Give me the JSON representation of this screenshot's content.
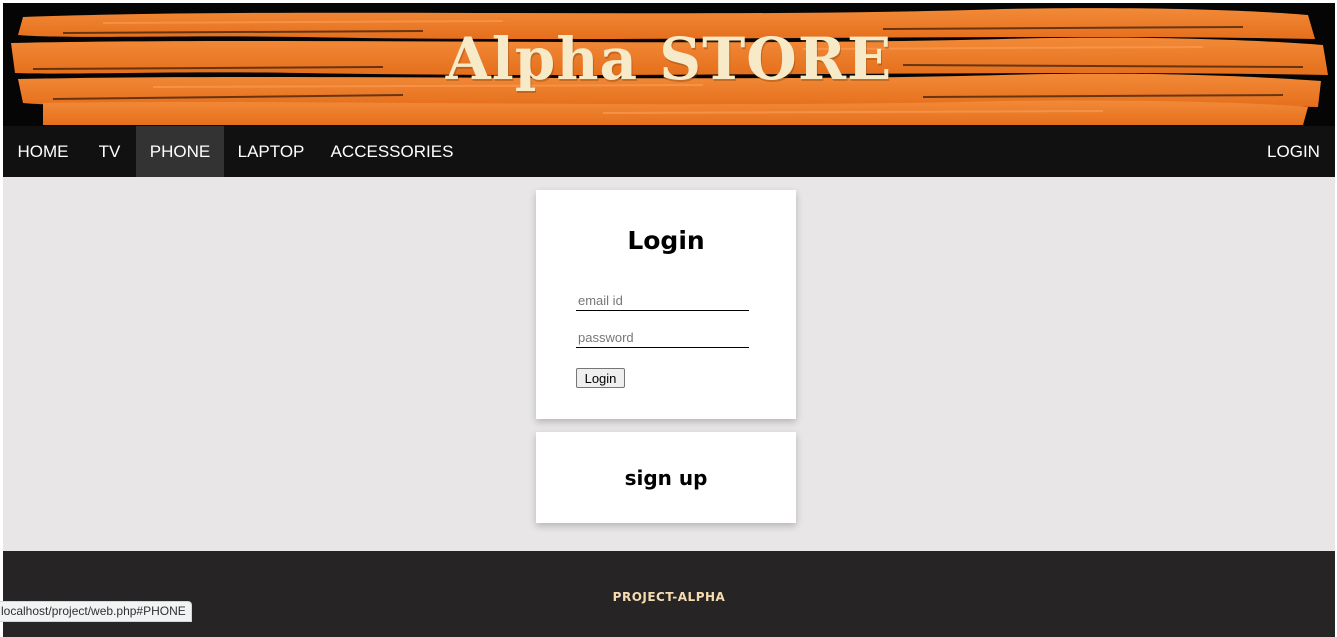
{
  "brand": {
    "title": "Alpha STORE"
  },
  "colors": {
    "accent": "#f07a26",
    "nav_bg": "#111111",
    "footer_bg": "#262425",
    "page_bg": "#e8e6e7"
  },
  "nav": {
    "items": [
      {
        "label": "HOME"
      },
      {
        "label": "TV"
      },
      {
        "label": "PHONE",
        "active": true
      },
      {
        "label": "LAPTOP"
      },
      {
        "label": "ACCESSORIES"
      }
    ],
    "login_label": "LOGIN"
  },
  "login": {
    "title": "Login",
    "email_placeholder": "email id",
    "password_placeholder": "password",
    "button_label": "Login"
  },
  "signup": {
    "title": "sign up"
  },
  "footer": {
    "text": "PROJECT-ALPHA"
  },
  "status_bar": {
    "url": "localhost/project/web.php#PHONE"
  }
}
